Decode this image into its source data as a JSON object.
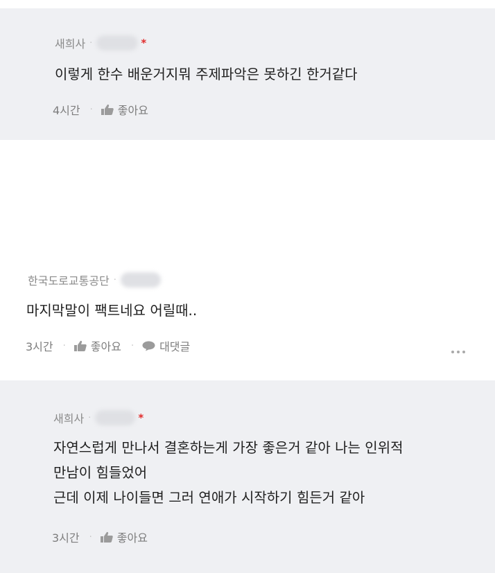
{
  "comments": [
    {
      "author": "새희사",
      "masked_id": "*",
      "body_lines": [
        "이렇게 한수 배운거지뭐 주제파악은 못하긴 한거같다"
      ],
      "time": "4시간",
      "like_label": "좋아요"
    },
    {
      "author": "한국도로교통공단",
      "masked_id": "",
      "body_lines": [
        "마지막말이 팩트네요 어릴때.."
      ],
      "time": "3시간",
      "like_label": "좋아요",
      "reply_label": "대댓글"
    },
    {
      "author": "새희사",
      "masked_id": "*",
      "body_lines": [
        "자연스럽게 만나서 결혼하는게 가장 좋은거 같아 나는  인위적",
        "만남이 힘들었어",
        "근데 이제 나이들면 그러 연애가 시작하기 힘든거 같아"
      ],
      "time": "3시간",
      "like_label": "좋아요"
    }
  ],
  "icons": {
    "like": "thumbs-up-icon",
    "reply": "speech-bubble-icon",
    "more": "more-dots-icon"
  },
  "colors": {
    "reply_bg": "#eff0f3",
    "accent_red": "#e12d2d"
  }
}
